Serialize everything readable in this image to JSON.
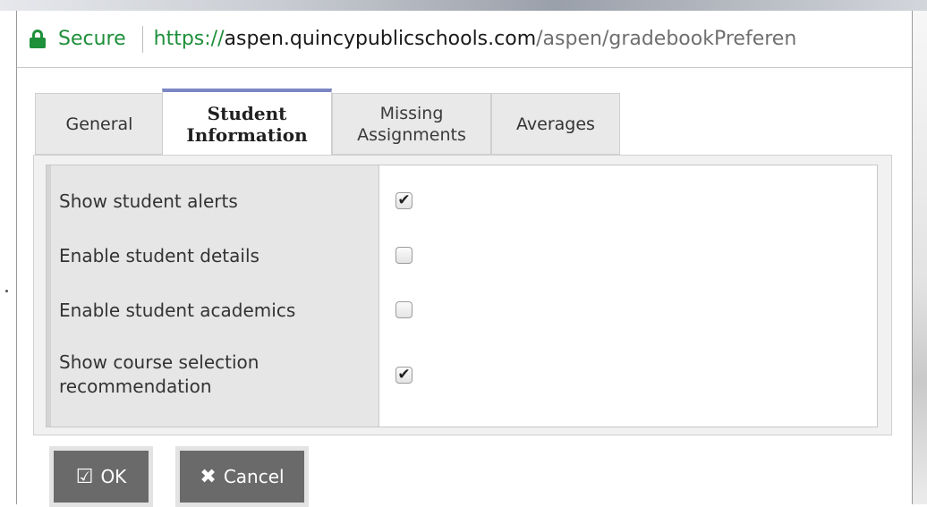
{
  "address_bar": {
    "secure_label": "Secure",
    "url_scheme": "https://",
    "url_host": "aspen.quincypublicschools.com",
    "url_path": "/aspen/gradebookPreferen"
  },
  "tabs": [
    {
      "label": "General",
      "active": false
    },
    {
      "label": "Student\nInformation",
      "active": true
    },
    {
      "label": "Missing\nAssignments",
      "active": false
    },
    {
      "label": "Averages",
      "active": false
    }
  ],
  "preferences": [
    {
      "label": "Show student alerts",
      "checked": true,
      "checkbox_glyph": "✔"
    },
    {
      "label": "Enable student details",
      "checked": false,
      "checkbox_glyph": ""
    },
    {
      "label": "Enable student academics",
      "checked": false,
      "checkbox_glyph": ""
    },
    {
      "label": "Show course selection\nrecommendation",
      "checked": true,
      "checkbox_glyph": "✔"
    }
  ],
  "buttons": {
    "ok_label": "OK",
    "cancel_label": "Cancel"
  },
  "icons": {
    "lock": "lock-icon",
    "ok": "checkbox-check-icon",
    "cancel": "close-x-icon"
  },
  "colors": {
    "secure_green": "#1e8f3a",
    "active_tab_accent": "#7b86c4",
    "button_bg": "#6a6a6a"
  }
}
